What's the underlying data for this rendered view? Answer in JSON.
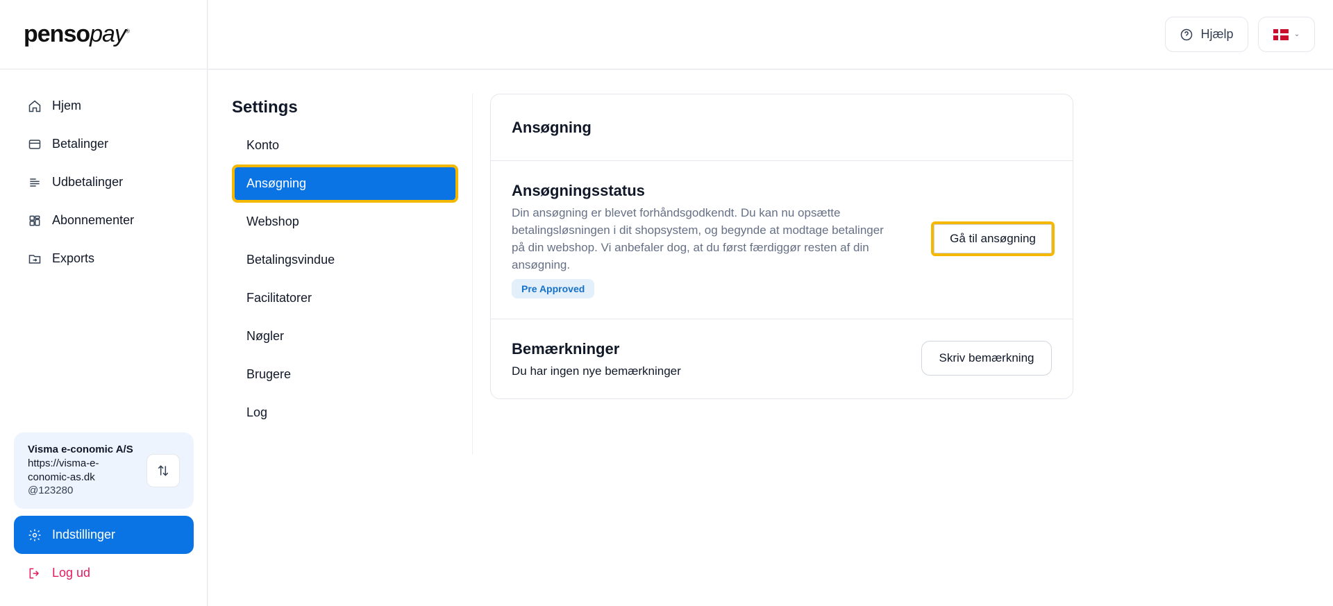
{
  "brand": {
    "logo_bold": "penso",
    "logo_italic": "pay",
    "logo_mark": "®"
  },
  "sidebar": {
    "items": [
      {
        "label": "Hjem",
        "icon": "home-icon"
      },
      {
        "label": "Betalinger",
        "icon": "card-icon"
      },
      {
        "label": "Udbetalinger",
        "icon": "list-icon"
      },
      {
        "label": "Abonnementer",
        "icon": "grid-icon"
      },
      {
        "label": "Exports",
        "icon": "folder-export-icon"
      }
    ],
    "merchant": {
      "name": "Visma e-conomic A/S",
      "url": "https://visma-e-conomic-as.dk",
      "id": "@123280"
    },
    "settings_label": "Indstillinger",
    "logout_label": "Log ud"
  },
  "header": {
    "help_label": "Hjælp",
    "language_flag": "Denmark"
  },
  "settings": {
    "title": "Settings",
    "items": [
      {
        "label": "Konto"
      },
      {
        "label": "Ansøgning",
        "active": true
      },
      {
        "label": "Webshop"
      },
      {
        "label": "Betalingsvindue"
      },
      {
        "label": "Facilitatorer"
      },
      {
        "label": "Nøgler"
      },
      {
        "label": "Brugere"
      },
      {
        "label": "Log"
      }
    ]
  },
  "card": {
    "title": "Ansøgning",
    "status": {
      "title": "Ansøgningsstatus",
      "text": "Din ansøgning er blevet forhåndsgodkendt. Du kan nu opsætte betalingsløsningen i dit shopsystem, og begynde at modtage betalinger på din webshop. Vi anbefaler dog, at du først færdiggør resten af din ansøgning.",
      "badge": "Pre Approved",
      "button": "Gå til ansøgning"
    },
    "remarks": {
      "title": "Bemærkninger",
      "text": "Du har ingen nye bemærkninger",
      "button": "Skriv bemærkning"
    }
  },
  "colors": {
    "accent": "#0b74e5",
    "highlight": "#f5b800",
    "logout": "#e11d62"
  }
}
